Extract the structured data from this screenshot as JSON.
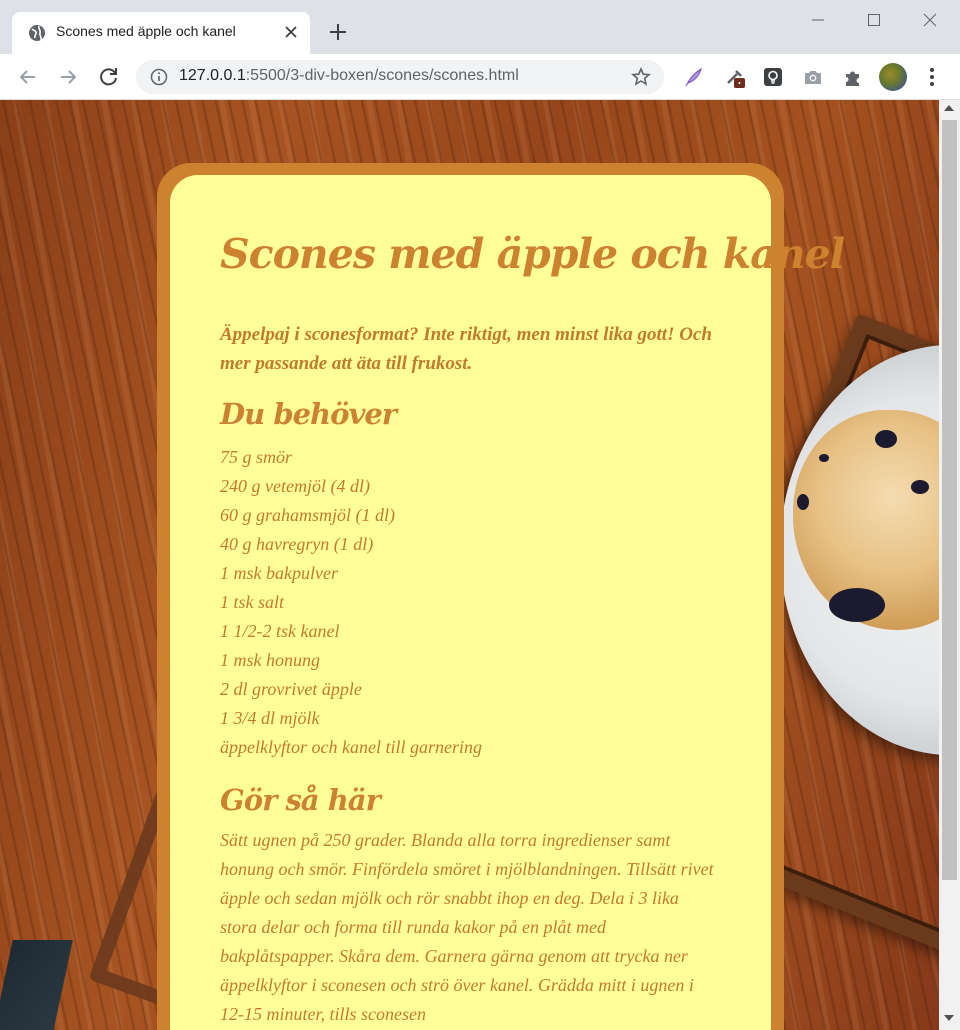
{
  "browser": {
    "tab_title": "Scones med äpple och kanel",
    "url_host": "127.0.0.1",
    "url_path": ":5500/3-div-boxen/scones/scones.html"
  },
  "recipe": {
    "title": "Scones med äpple och kanel",
    "intro": "Äppelpaj i sconesformat? Inte riktigt, men minst lika gott! Och mer passande att äta till frukost.",
    "ingredients_heading": "Du behöver",
    "ingredients": [
      "75 g smör",
      "240 g vetemjöl (4 dl)",
      "60 g grahamsmjöl (1 dl)",
      "40 g havregryn (1 dl)",
      "1 msk bakpulver",
      "1 tsk salt",
      "1 1/2-2 tsk kanel",
      "1 msk honung",
      "2 dl grovrivet äpple",
      "1 3/4 dl mjölk",
      "äppelklyftor och kanel till garnering"
    ],
    "steps_heading": "Gör så här",
    "steps": "Sätt ugnen på 250 grader. Blanda alla torra ingredienser samt honung och smör. Finfördela smöret i mjölblandningen. Tillsätt rivet äpple och sedan mjölk och rör snabbt ihop en deg. Dela i 3 lika stora delar och forma till runda kakor på en plåt med bakplåtspapper. Skåra dem. Garnera gärna genom att trycka ner äppelklyftor i sconesen och strö över kanel. Grädda mitt i ugnen i 12-15 minuter, tills sconesen"
  },
  "colors": {
    "card_border": "#cd8230",
    "card_fill": "#ffff99",
    "text": "#c07b2e"
  },
  "icons": {
    "tab_favicon": "globe-icon",
    "extensions": [
      "quill-icon",
      "eyedropper-icon",
      "lightbulb-icon",
      "camera-icon",
      "puzzle-icon"
    ]
  }
}
